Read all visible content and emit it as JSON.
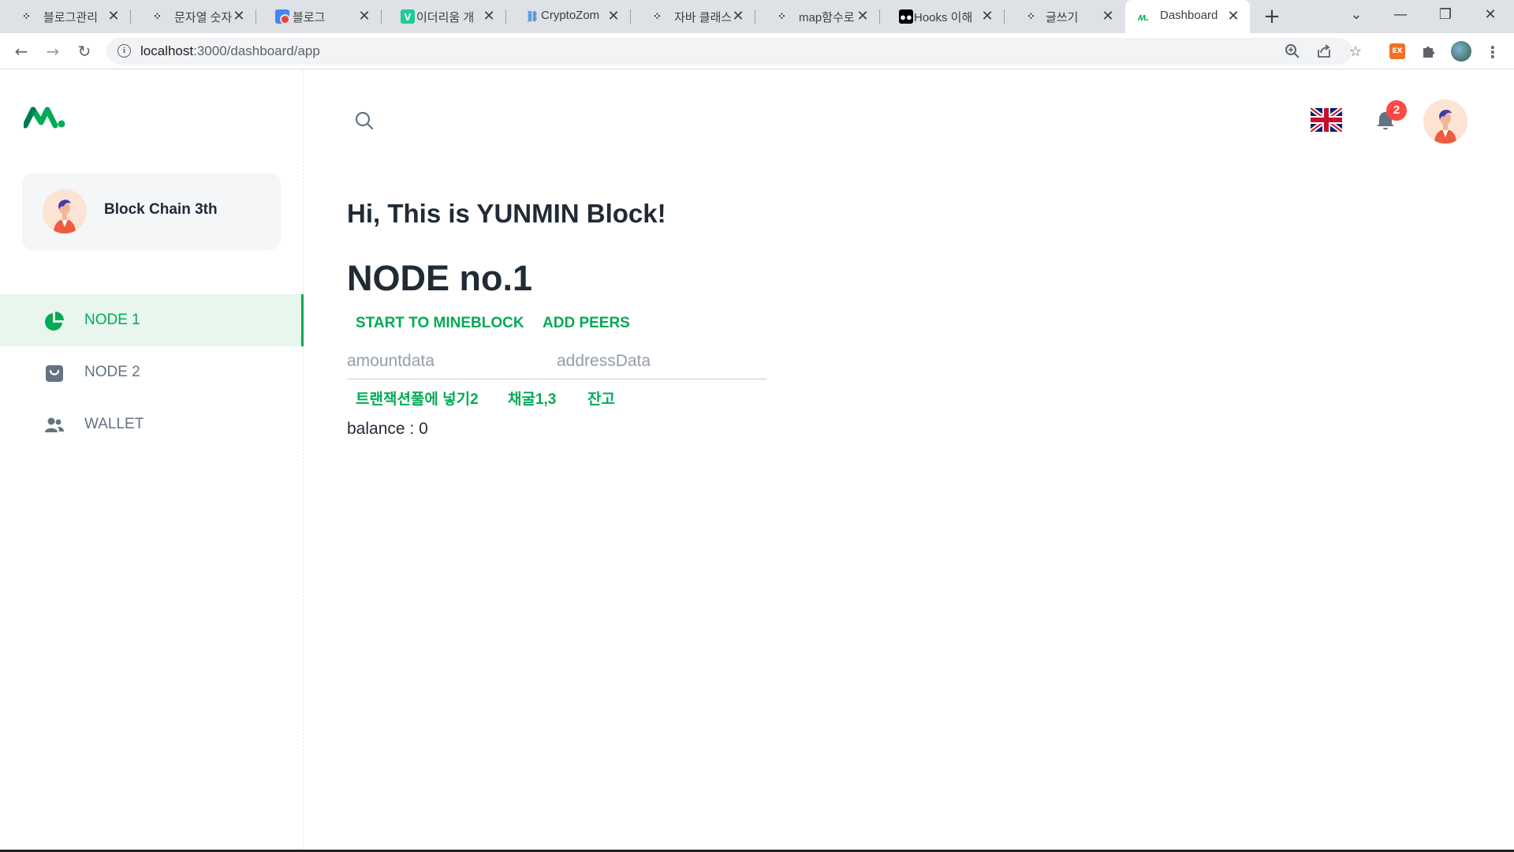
{
  "browser": {
    "tabs": [
      {
        "label": "블로그관리",
        "icon": "velog-dots-icon"
      },
      {
        "label": "문자열 숫자",
        "icon": "velog-dots-icon"
      },
      {
        "label": "블로그",
        "icon": "google-icon"
      },
      {
        "label": "이더리움 개",
        "icon": "v-icon"
      },
      {
        "label": "CryptoZom",
        "icon": "link-icon"
      },
      {
        "label": "자바 클래스",
        "icon": "velog-dots-icon"
      },
      {
        "label": "map함수로",
        "icon": "velog-dots-icon"
      },
      {
        "label": "Hooks 이해",
        "icon": "medium-icon"
      },
      {
        "label": "글쓰기",
        "icon": "velog-dots-icon"
      },
      {
        "label": "Dashboard",
        "icon": "minimal-logo-icon",
        "active": true
      }
    ],
    "url_host": "localhost",
    "url_path": ":3000/dashboard/app",
    "ext_label": "EX"
  },
  "sidebar": {
    "account_name": "Block Chain 3th",
    "nav": [
      {
        "label": "NODE 1",
        "icon": "pie-chart-icon",
        "active": true
      },
      {
        "label": "NODE 2",
        "icon": "shopping-bag-icon",
        "active": false
      },
      {
        "label": "WALLET",
        "icon": "people-icon",
        "active": false
      }
    ]
  },
  "header": {
    "notification_count": "2",
    "language": "uk-flag-icon"
  },
  "main": {
    "greeting": "Hi, This is YUNMIN Block!",
    "node_title": "NODE no.1",
    "start_button": "START TO MINEBLOCK",
    "peers_button": "ADD PEERS",
    "amount_placeholder": "amountdata",
    "address_placeholder": "addressData",
    "tx_button": "트랜잭션풀에 넣기2",
    "mine_button": "채굴1,3",
    "balance_button": "잔고",
    "balance_text": "balance : 0"
  },
  "colors": {
    "primary": "#00ab55",
    "text": "#212b36",
    "muted": "#637381",
    "badge": "#ff4842"
  }
}
